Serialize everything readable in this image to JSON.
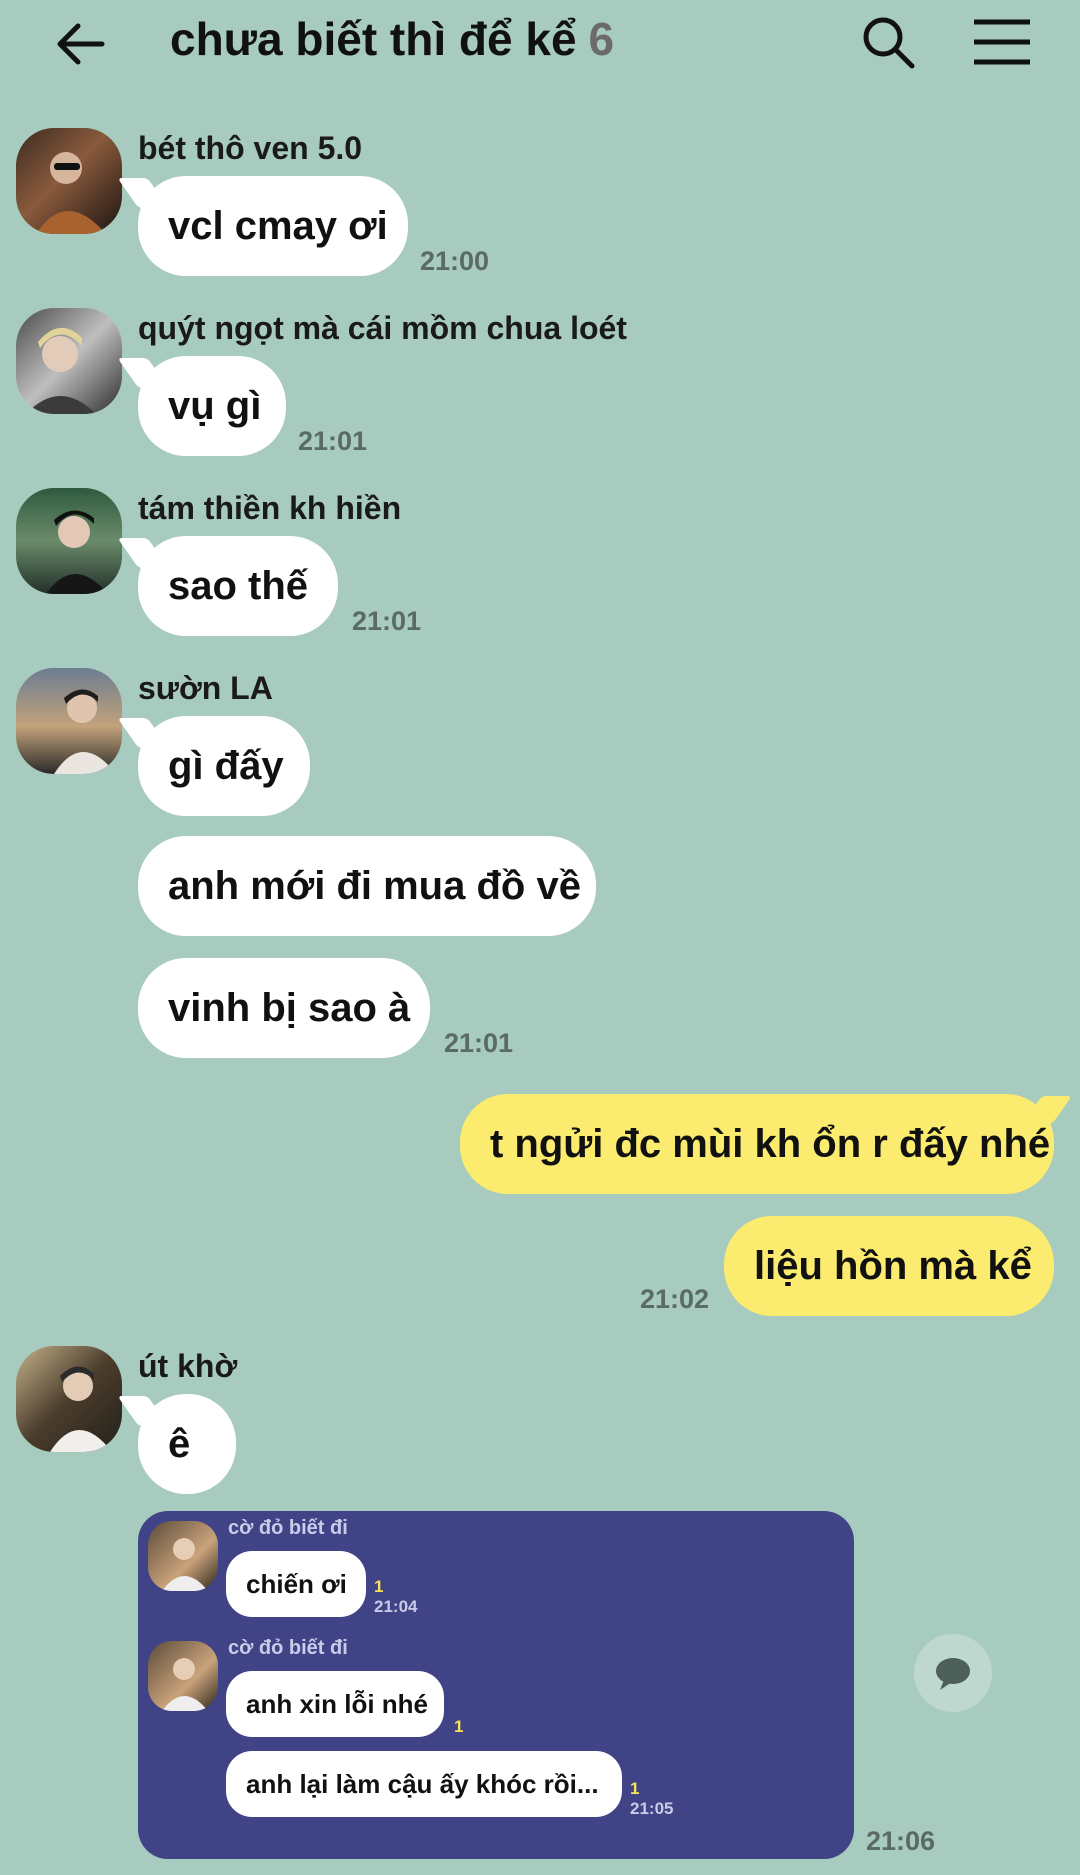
{
  "header": {
    "title": "chưa biết thì để kể",
    "member_count": "6",
    "icons": [
      "back-arrow-icon",
      "search-icon",
      "menu-icon"
    ]
  },
  "messages": [
    {
      "sender": "bét thô ven 5.0",
      "avatar": "avatar-1",
      "bubbles": [
        "vcl cmay ơi"
      ],
      "time": "21:00"
    },
    {
      "sender": "quýt ngọt mà cái mồm chua loét",
      "avatar": "avatar-2",
      "bubbles": [
        "vụ gì"
      ],
      "time": "21:01"
    },
    {
      "sender": "tám thiền kh hiền",
      "avatar": "avatar-3",
      "bubbles": [
        "sao thế"
      ],
      "time": "21:01"
    },
    {
      "sender": "sườn LA",
      "avatar": "avatar-4",
      "bubbles": [
        "gì đấy",
        "anh mới đi mua đồ về",
        "vinh bị sao à"
      ],
      "time": "21:01"
    },
    {
      "sender": "me",
      "bubbles": [
        "t ngửi đc mùi kh ổn r đấy nhé",
        "liệu hồn mà kể"
      ],
      "time": "21:02"
    },
    {
      "sender": "út khờ",
      "avatar": "avatar-5",
      "bubbles": [
        "ê"
      ],
      "time": "21:06"
    }
  ],
  "forwarded_image": {
    "items": [
      {
        "sender": "cờ đỏ biết đi",
        "bubbles": [
          {
            "text": "chiến ơi",
            "read": "1",
            "time": "21:04"
          }
        ]
      },
      {
        "sender": "cờ đỏ biết đi",
        "bubbles": [
          {
            "text": "anh xin lỗi nhé",
            "read": "1",
            "time": ""
          },
          {
            "text": "anh lại làm cậu ấy khóc rồi...",
            "read": "1",
            "time": "21:05"
          }
        ]
      }
    ]
  },
  "colors": {
    "background": "#a8cbbf",
    "my_bubble": "#fbeb6f",
    "other_bubble": "#ffffff",
    "forwarded_card": "#404386"
  }
}
